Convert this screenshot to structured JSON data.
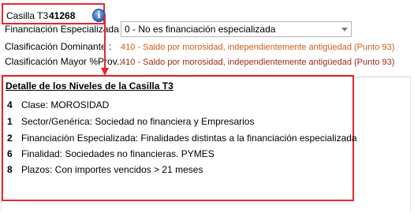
{
  "header": {
    "casilla_label": "Casilla T3 :",
    "casilla_value": "41268",
    "info_icon": "info-icon",
    "financiacion_label": "Financiación Especializada :",
    "financiacion_selected": "0 - No es financiación especializada",
    "clasificacion_dominante_label": "Clasificación Dominante :",
    "clasificacion_dominante_value": "410 - Saldo por morosidad, independientemente antigüedad  (Punto 93)",
    "clasificacion_mayor_label": "Clasificación Mayor %Prov.:",
    "clasificacion_mayor_value": "410 - Saldo por morosidad, independientemente antigüedad  (Punto 93)"
  },
  "detail": {
    "title": "Detalle de los Niveles de la Casilla T3",
    "levels": [
      {
        "num": "4",
        "text": "Clase: MOROSIDAD"
      },
      {
        "num": "1",
        "text": "Sector/Genérica: Sociedad no financiera y Empresarios"
      },
      {
        "num": "2",
        "text": "Financiación Especializada: Finalidades distintas a la financiación especializada"
      },
      {
        "num": "6",
        "text": "Finalidad: Sociedades no financieras. PYMES"
      },
      {
        "num": "8",
        "text": "Plazos: Con importes vencidos  >  21 meses"
      }
    ]
  },
  "colors": {
    "highlight_red": "#e8262d",
    "orange_value": "#d05c17",
    "dark_red_value": "#9c2a16"
  }
}
